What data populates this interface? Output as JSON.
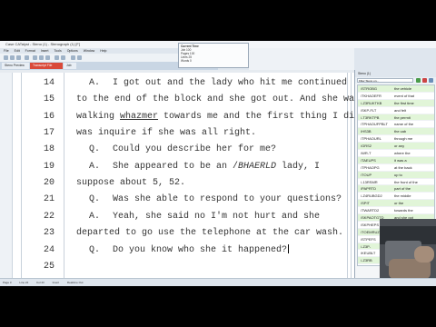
{
  "window": {
    "title": "Case CATalyst - Steno (1) - Stenograph (1) [F]"
  },
  "menu": [
    "File",
    "Edit",
    "Format",
    "Insert",
    "Tools",
    "Options",
    "Window",
    "Help"
  ],
  "tabs": [
    {
      "label": "Steno Preview"
    },
    {
      "label": "Transcript File"
    },
    {
      "label": "Job"
    }
  ],
  "popup": {
    "title": "Current Time",
    "rows": [
      "Job 100",
      "Pages 100",
      "Lines 25",
      "Words 0"
    ]
  },
  "transcript": [
    {
      "num": "14",
      "spk": "A.",
      "text": "I got out and the lady who hit me continued",
      "indent": true
    },
    {
      "num": "15",
      "spk": "",
      "text": "to the end of the block and she got out.  And she was",
      "indent": false
    },
    {
      "num": "16",
      "spk": "",
      "pre": "walking ",
      "u": "whazmer",
      "post": " towards me and the first thing I did",
      "indent": false
    },
    {
      "num": "17",
      "spk": "",
      "text": "was inquire if she was all right.",
      "indent": false
    },
    {
      "num": "18",
      "spk": "Q.",
      "text": "Could you describe her for me?",
      "indent": true
    },
    {
      "num": "19",
      "spk": "A.",
      "pre": "She appeared to be an /",
      "i": "BHAERLD",
      "post": " lady, I",
      "indent": true
    },
    {
      "num": "20",
      "spk": "",
      "text": "suppose about 5, 52.",
      "indent": false
    },
    {
      "num": "21",
      "spk": "Q.",
      "text": "Was she able to respond to your questions?",
      "indent": true
    },
    {
      "num": "22",
      "spk": "A.",
      "text": "Yeah, she said no I'm not hurt and she",
      "indent": true
    },
    {
      "num": "23",
      "spk": "",
      "text": "departed to go use the telephone at the car wash.",
      "indent": false
    },
    {
      "num": "24",
      "spk": "Q.",
      "text": "Do you know who she it happened?",
      "indent": true,
      "cursor": true
    },
    {
      "num": "25",
      "spk": "",
      "text": "",
      "indent": false
    }
  ],
  "steno_panel": {
    "title": "Steno (1)",
    "search_placeholder": "Filter Steno on...",
    "rows": [
      {
        "steno": "/STROBG",
        "word": "the vehicle"
      },
      {
        "steno": "/TKHAOEFR",
        "word": "event of that"
      },
      {
        "steno": "/-Z3RUKTKB",
        "word": "the first time"
      },
      {
        "steno": "/SKP-FLT",
        "word": "and felt"
      },
      {
        "steno": "/-T3RKTPB",
        "word": "the permit"
      },
      {
        "steno": "/TPHAOUFPBLT",
        "word": "name of the"
      },
      {
        "steno": "/HS3B",
        "word": "the cab"
      },
      {
        "steno": "/TPHAOURL",
        "word": "through me"
      },
      {
        "steno": "/GRS2",
        "word": "or any"
      },
      {
        "steno": "/WR-T",
        "word": "where the"
      },
      {
        "steno": "/TAEUPS",
        "word": "it was a"
      },
      {
        "steno": "/TPHAOPG",
        "word": "at the back"
      },
      {
        "steno": "/TOUP",
        "word": "up to"
      },
      {
        "steno": "/-13RSMR",
        "word": "the front of the"
      },
      {
        "steno": "/PAPRTD",
        "word": "part of the"
      },
      {
        "steno": "/-Z4RUBGD2",
        "word": "the middle"
      },
      {
        "steno": "/SPIT",
        "word": "or the"
      },
      {
        "steno": "/TWARTD2",
        "word": "towards the"
      },
      {
        "steno": "/SKPAOTGTD",
        "word": "and she got"
      },
      {
        "steno": "/SKPHEPS",
        "word": "and she was"
      },
      {
        "steno": "/TOEMRUZ",
        "word": "towards me"
      },
      {
        "steno": "/STPEFS",
        "word": "if she was"
      },
      {
        "steno": "/-Z3P-",
        "word": "52"
      },
      {
        "steno": "/KEUBLT",
        "word": "able to"
      },
      {
        "steno": "/-Z3RB",
        "word": ""
      }
    ]
  },
  "status": {
    "page": "Page 3",
    "line": "Line 24",
    "col": "Col 43",
    "mode": "Insert",
    "extra": "Realtime Out"
  }
}
